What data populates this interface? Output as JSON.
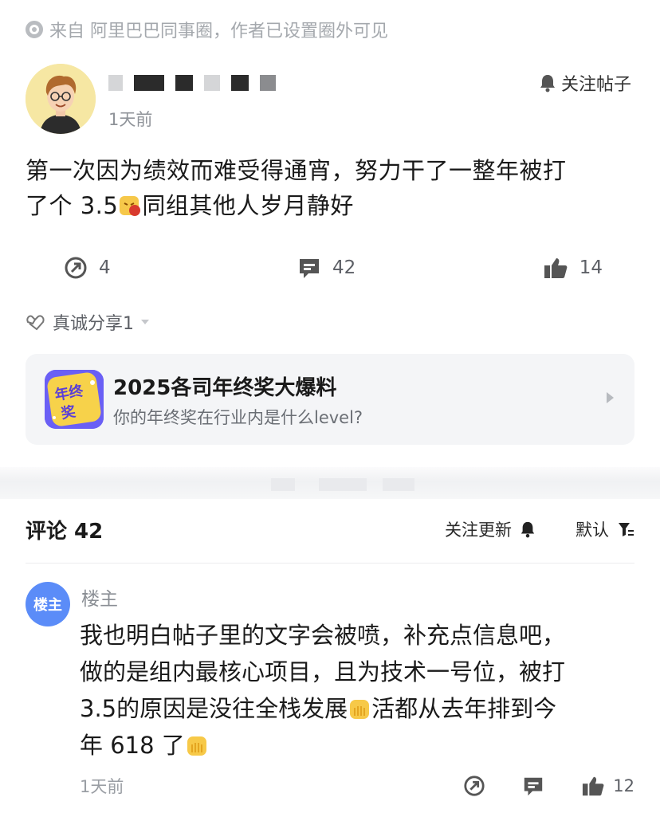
{
  "source": {
    "text": "来自 阿里巴巴同事圈，作者已设置圈外可见"
  },
  "post": {
    "time": "1天前",
    "follow_label": "关注帖子",
    "body_line1": "第一次因为绩效而难受得通宵，努力干了一整年被打",
    "body_line2_pre": "了个 3.5",
    "body_line2_post": "同组其他人岁月静好",
    "actions": {
      "share_count": "4",
      "comment_count": "42",
      "like_count": "14"
    },
    "share_info": "真诚分享1"
  },
  "promo": {
    "logo_text": "年终奖",
    "title": "2025各司年终奖大爆料",
    "subtitle": "你的年终奖在行业内是什么level?"
  },
  "comments": {
    "title": "评论 42",
    "follow_updates": "关注更新",
    "sort_label": "默认",
    "items": [
      {
        "avatar_label": "楼主",
        "author": "楼主",
        "line1": "我也明白帖子里的文字会被喷，补充点信息吧，",
        "line2": "做的是组内最核心项目，且为技术一号位，被打",
        "line3_pre": "3.5的原因是没往全栈发展",
        "line3_post": "活都从去年排到今",
        "line4": "年 618 了",
        "time": "1天前",
        "like_count": "12"
      }
    ]
  },
  "colors": {
    "accent": "#5b8cf8",
    "promo_logo": "#6a5ff5",
    "muted": "#9a9ea4"
  },
  "icons": [
    "shield-dot-icon",
    "bell-icon",
    "share-icon",
    "comment-icon",
    "thumb-up-icon",
    "heart-hands-icon",
    "sort-icon",
    "chevron-right-icon"
  ]
}
